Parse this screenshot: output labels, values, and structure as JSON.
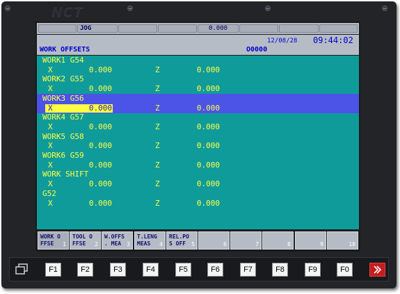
{
  "brand": {
    "logo": "NCT"
  },
  "status_bar": {
    "cells": [
      "",
      "JOG",
      "",
      "",
      "0.000",
      "",
      "",
      ""
    ],
    "date": "12/08/28",
    "time": "09:44:02"
  },
  "title": {
    "label": "WORK OFFSETS",
    "program": "O0000"
  },
  "rows": [
    {
      "type": "header",
      "text": "WORK1 G54"
    },
    {
      "type": "values",
      "x": "0.000",
      "z": "0.000"
    },
    {
      "type": "header",
      "text": "WORK2 G55"
    },
    {
      "type": "values",
      "x": "0.000",
      "z": "0.000"
    },
    {
      "type": "header",
      "text": "WORK3 G56",
      "selected": true
    },
    {
      "type": "values",
      "x": "0.000",
      "z": "0.000",
      "selected": true,
      "cursor": true
    },
    {
      "type": "header",
      "text": "WORK4 G57"
    },
    {
      "type": "values",
      "x": "0.000",
      "z": "0.000"
    },
    {
      "type": "header",
      "text": "WORK5 G58"
    },
    {
      "type": "values",
      "x": "0.000",
      "z": "0.000"
    },
    {
      "type": "header",
      "text": "WORK6 G59"
    },
    {
      "type": "values",
      "x": "0.000",
      "z": "0.000"
    },
    {
      "type": "header",
      "text": "WORK SHIFT"
    },
    {
      "type": "values",
      "x": "0.000",
      "z": "0.000"
    },
    {
      "type": "header",
      "text": "G52"
    },
    {
      "type": "values",
      "x": "0.000",
      "z": "0.000"
    }
  ],
  "axis_labels": {
    "x": "X",
    "z": "Z"
  },
  "softkeys": [
    {
      "line1": "WORK O",
      "line2": "FFSE",
      "num": "1",
      "active": true
    },
    {
      "line1": "TOOL O",
      "line2": "FFSE",
      "num": "2"
    },
    {
      "line1": "W.OFFS",
      "line2": ". MEA",
      "num": "3"
    },
    {
      "line1": "T.LENG",
      "line2": "MEAS",
      "num": "4"
    },
    {
      "line1": "REL.PO",
      "line2": "S OFF",
      "num": "5"
    },
    {
      "line1": "",
      "line2": "",
      "num": "6"
    },
    {
      "line1": "",
      "line2": "",
      "num": "7"
    },
    {
      "line1": "",
      "line2": "",
      "num": "8"
    },
    {
      "line1": "",
      "line2": "",
      "num": "9"
    },
    {
      "line1": "",
      "line2": "",
      "num": "10"
    }
  ],
  "function_keys": [
    "F1",
    "F2",
    "F3",
    "F4",
    "F5",
    "F6",
    "F7",
    "F8",
    "F9",
    "F0"
  ],
  "icons": {
    "left": "window-switch-icon",
    "right": "exit-icon"
  },
  "colors": {
    "background": "#109b9b",
    "text": "#ffff44",
    "selected_row": "#4b54e6",
    "panel": "#b6bcc6"
  }
}
